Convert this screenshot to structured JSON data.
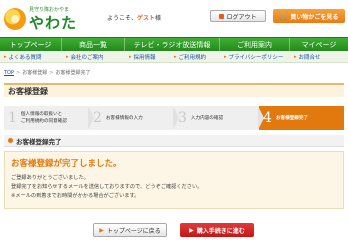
{
  "header": {
    "logo_tagline": "見守り隊おかやま",
    "logo_text": "やわた",
    "welcome_prefix": "ようこそ、",
    "welcome_guest": "ゲスト",
    "welcome_suffix": "様",
    "login_label": "ログアウト",
    "cart_label": "買い物かごを見る"
  },
  "nav": {
    "items": [
      "トップページ",
      "商品一覧",
      "テレビ・ラジオ放送情報",
      "ご利用案内",
      "マイページ"
    ]
  },
  "subnav": {
    "items": [
      "よくある質問",
      "会社のご案内",
      "採用情報",
      "ご利用規約",
      "プライバシーポリシー",
      "お問合せ"
    ]
  },
  "breadcrumb": {
    "home": "TOP",
    "sep": ">",
    "level2": "お客様登録",
    "level3": "お客様登録完了"
  },
  "page_title": "お客様登録",
  "steps": [
    {
      "num": "1",
      "line1": "個人情報の取扱いと",
      "line2": "ご利用規約の同意確認"
    },
    {
      "num": "2",
      "line1": "お客様情報の入力",
      "line2": ""
    },
    {
      "num": "3",
      "line1": "入力内容の確認",
      "line2": ""
    },
    {
      "num": "4",
      "line1": "お客様登録完了",
      "line2": ""
    }
  ],
  "section_heading": "お客様登録完了",
  "complete": {
    "title": "お客様登録が完了しました。",
    "line1": "ご登録ありがとうございました。",
    "line2": "登録完了をお知らせするメールを送信しておりますので、どうぞご確認ください。",
    "line3": "※メールの到着までお時間がかかる場合がございます。"
  },
  "buttons": {
    "top_label": "トップページに戻る",
    "buy_label": "購入手続きに進む"
  },
  "colors": {
    "brand_green": "#228a1b",
    "accent_orange": "#e2790f",
    "buy_red": "#c11717"
  }
}
